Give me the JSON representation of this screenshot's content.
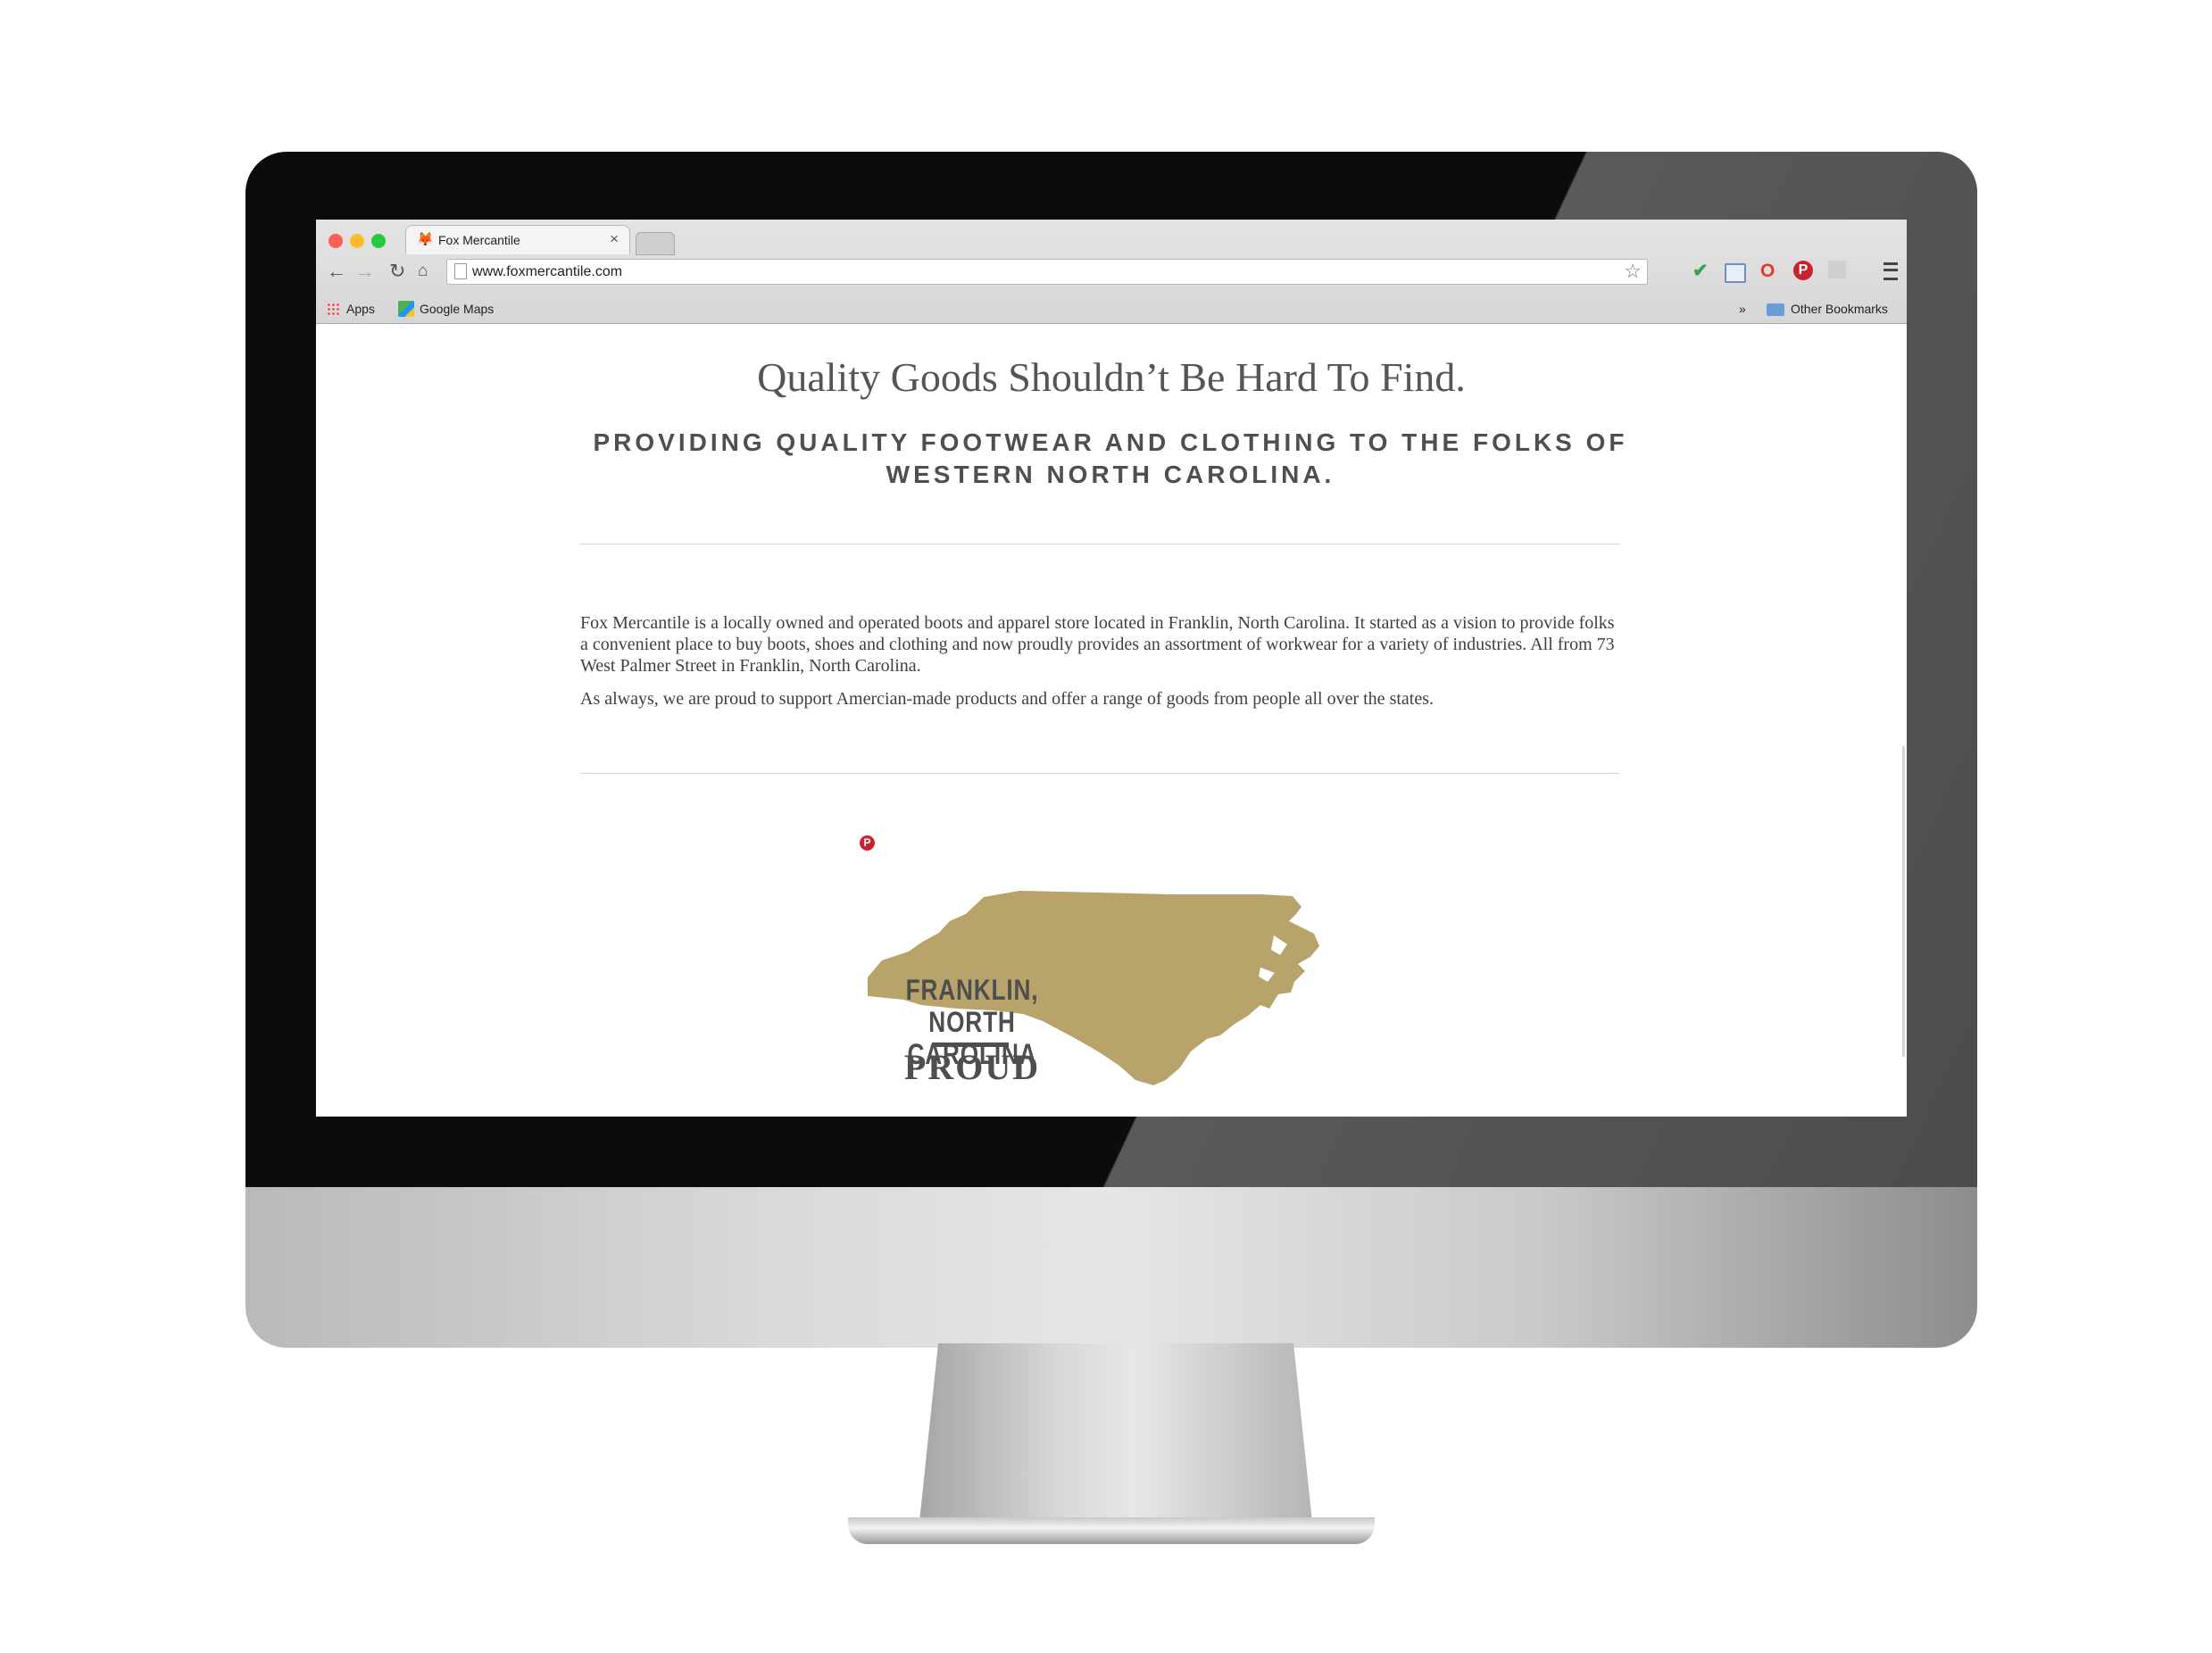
{
  "browser": {
    "tab_title": "Fox Mercantile",
    "tab_close": "×",
    "url": "www.foxmercantile.com",
    "bookmarks": {
      "apps": "Apps",
      "google_maps": "Google Maps",
      "overflow": "»",
      "other": "Other Bookmarks"
    }
  },
  "page": {
    "headline": "Quality Goods Shouldn’t Be Hard To Find.",
    "subheadline": "PROVIDING QUALITY FOOTWEAR AND CLOTHING TO THE FOLKS OF WESTERN NORTH CAROLINA.",
    "paragraph_1": "Fox Mercantile is a locally owned and operated boots and apparel store located in Franklin, North Carolina. It started as a vision to provide folks a convenient place to buy boots, shoes and clothing and now proudly provides an assortment of workwear for a variety of industries. All from 73 West Palmer Street in Franklin, North Carolina.",
    "paragraph_2": "As always, we are proud to support Amercian-made products and offer a range of goods from people all over the states.",
    "badge": {
      "line_1": "FRANKLIN,",
      "line_2": "NORTH CAROLINA",
      "line_3": "PROUD",
      "map_color": "#b8a46a",
      "text_color": "#4e4e4e"
    }
  },
  "icons": [
    "fox-icon",
    "back-icon",
    "forward-icon",
    "reload-icon",
    "home-icon",
    "star-icon",
    "checkmark-icon",
    "calendar-icon",
    "opera-icon",
    "pinterest-icon",
    "puzzle-icon",
    "menu-icon",
    "apps-icon",
    "google-maps-icon",
    "folder-icon"
  ]
}
